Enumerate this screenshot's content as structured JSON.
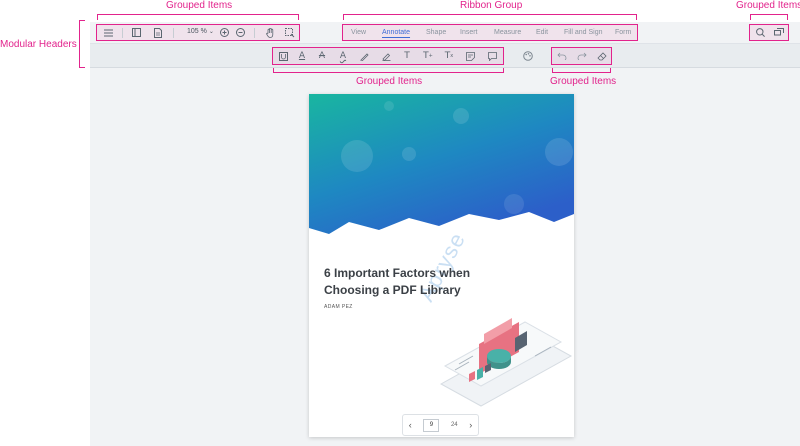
{
  "annotations": {
    "grouped_items_top_left": "Grouped Items",
    "ribbon_group": "Ribbon Group",
    "grouped_items_top_right": "Grouped Items",
    "modular_headers": "Modular Headers",
    "grouped_items_tools": "Grouped Items",
    "grouped_items_history": "Grouped Items"
  },
  "toolbar": {
    "zoom": "105 %",
    "menu_icon": "menu-icon",
    "panel_icon": "panel-icon",
    "document_icon": "document-icon",
    "zoom_in_icon": "zoom-in-icon",
    "zoom_out_icon": "zoom-out-icon",
    "pan_icon": "hand-icon",
    "select_icon": "selection-icon",
    "search_icon": "search-icon",
    "comments_icon": "comments-icon"
  },
  "ribbon": {
    "tabs": [
      "View",
      "Annotate",
      "Shape",
      "Insert",
      "Measure",
      "Edit",
      "Fill and Sign",
      "Form"
    ],
    "active": "Annotate"
  },
  "tools": {
    "icons": [
      "underline-tool-icon",
      "highlight-text-icon",
      "strikeout-text-icon",
      "squiggly-text-icon",
      "freehand-icon",
      "freehand-highlight-icon",
      "free-text-icon",
      "text-insert-icon",
      "text-replace-icon",
      "sticky-note-icon",
      "comment-icon"
    ],
    "style_icon": "palette-icon",
    "history_icons": [
      "undo-icon",
      "redo-icon",
      "eraser-icon"
    ]
  },
  "document": {
    "title_line1": "6 Important Factors when",
    "title_line2": "Choosing a PDF Library",
    "author": "ADAM PEZ",
    "watermark": "Apryse"
  },
  "pager": {
    "current_page": "9",
    "total_pages": "24"
  },
  "colors": {
    "annotation": "#e2238c",
    "active_tab": "#3f6ed6",
    "cover_top": "#15a9a0",
    "cover_bottom": "#2764c8"
  }
}
